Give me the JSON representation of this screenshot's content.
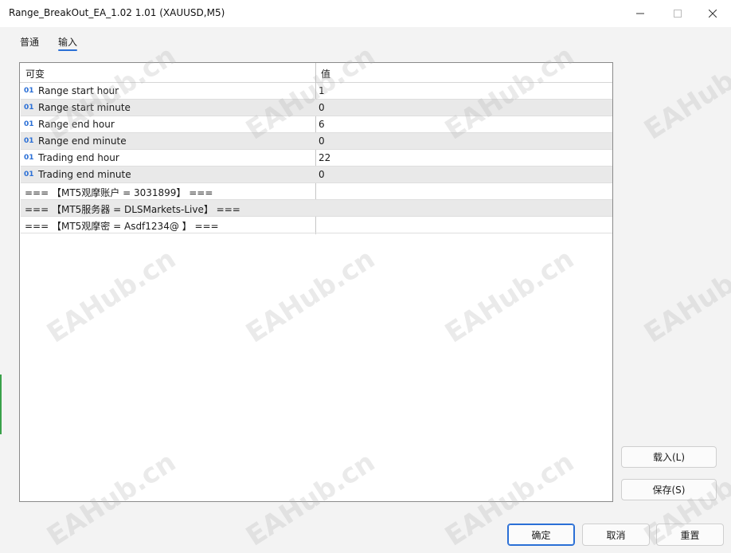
{
  "window": {
    "title": "Range_BreakOut_EA_1.02 1.01 (XAUUSD,M5)"
  },
  "tabs": [
    {
      "label": "普通"
    },
    {
      "label": "输入"
    }
  ],
  "grid": {
    "col_variable": "可变",
    "col_value": "值",
    "type_badge": "01",
    "rows": [
      {
        "name": "Range start hour",
        "value": "1"
      },
      {
        "name": "Range start minute",
        "value": "0"
      },
      {
        "name": "Range end hour",
        "value": "6"
      },
      {
        "name": "Range end minute",
        "value": "0"
      },
      {
        "name": "Trading end hour",
        "value": "22"
      },
      {
        "name": "Trading end minute",
        "value": "0"
      },
      {
        "name": "=== 【MT5观摩账户 = 3031899】 ===",
        "value": ""
      },
      {
        "name": "=== 【MT5服务器 = DLSMarkets-Live】 ===",
        "value": ""
      },
      {
        "name": "=== 【MT5观摩密 = Asdf1234@   】 ===",
        "value": ""
      }
    ]
  },
  "buttons": {
    "load": "载入(L)",
    "save": "保存(S)",
    "ok": "确定",
    "cancel": "取消",
    "reset": "重置"
  },
  "watermark": "EAHub.cn",
  "colors": {
    "accent": "#2a6fd6",
    "alt_row": "#e9e9e9"
  }
}
